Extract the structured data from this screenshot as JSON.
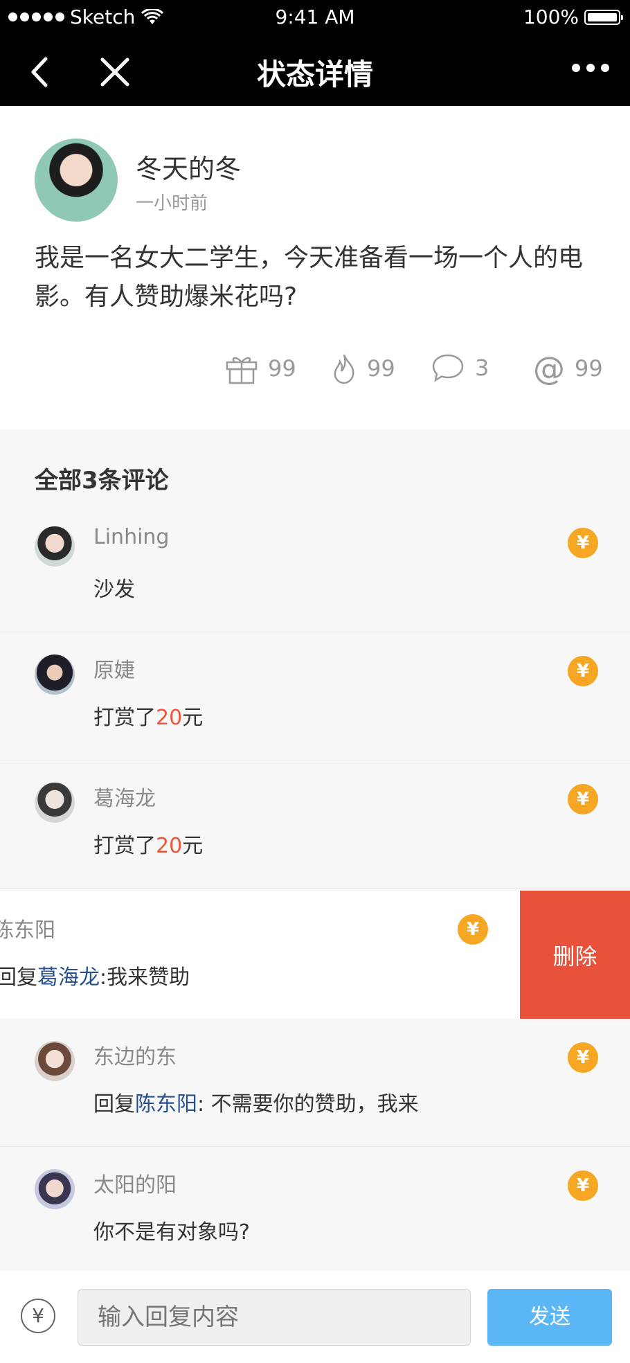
{
  "status_bar": {
    "carrier": "Sketch",
    "time": "9:41 AM",
    "battery": "100%"
  },
  "nav": {
    "title": "状态详情"
  },
  "post": {
    "author": "冬天的冬",
    "time": "一小时前",
    "content": "我是一名女大二学生，今天准备看一场一个人的电影。有人赞助爆米花吗?",
    "stats": {
      "gifts": "99",
      "hot": "99",
      "comments": "3",
      "mentions": "99"
    }
  },
  "comments": {
    "header": "全部3条评论",
    "items": [
      {
        "name": "Linhing",
        "text": "沙发"
      },
      {
        "name": "原婕",
        "prefix": "打赏了",
        "amount": "20",
        "suffix": "元"
      },
      {
        "name": "葛海龙",
        "prefix": "打赏了",
        "amount": "20",
        "suffix": "元"
      }
    ],
    "swiped": {
      "name": "陈东阳",
      "prefix": "回复",
      "target": "葛海龙",
      "text": ":我来赞助",
      "delete_label": "删除"
    },
    "items_after": [
      {
        "name": "东边的东",
        "prefix": "回复",
        "target": "陈东阳",
        "text": ": 不需要你的赞助，我来"
      },
      {
        "name": "太阳的阳",
        "text": "你不是有对象吗?"
      }
    ],
    "coin_symbol": "¥"
  },
  "reply_bar": {
    "placeholder": "输入回复内容",
    "send_label": "发送",
    "yen_symbol": "¥"
  },
  "colors": {
    "accent_coin": "#f5a623",
    "delete": "#e8513a",
    "send": "#5ab6f5",
    "money": "#f0553a",
    "link": "#26508f"
  }
}
